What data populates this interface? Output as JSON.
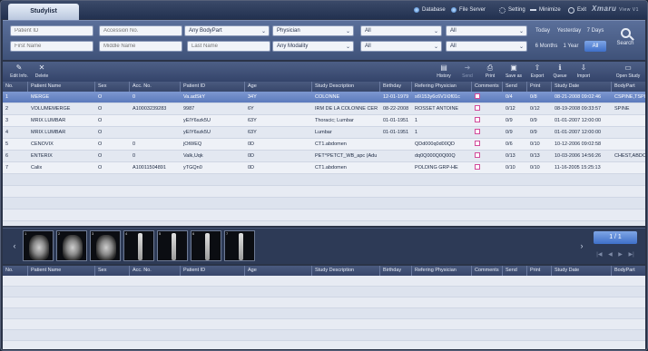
{
  "titlebar": {
    "tab": "Studylist",
    "database": "Database",
    "file_server": "File Server",
    "setting": "Setting",
    "minimize": "Minimize",
    "exit": "Exit",
    "brand": "Xmaru",
    "brand_sub": "View V1"
  },
  "search": {
    "patient_id": "Patient ID",
    "accession_no": "Accession No.",
    "first_name": "First Name",
    "middle_name": "Middle Name",
    "last_name": "Last Name",
    "bodypart": "Any BodyPart",
    "modality": "Any Modality",
    "physician": "Physician",
    "all_1": "All",
    "all_2": "All",
    "all_3": "All",
    "all_4": "All",
    "dates": {
      "today": "Today",
      "yesterday": "Yesterday",
      "seven_days": "7 Days",
      "six_months": "6 Months",
      "one_year": "1 Year",
      "all": "All"
    },
    "search_button": "Search"
  },
  "toolbar": {
    "edit_info": "Edit Info.",
    "delete": "Delete",
    "history": "History",
    "send": "Send",
    "print": "Print",
    "save_as": "Save as",
    "export": "Export",
    "queue": "Queue",
    "import": "Import",
    "open_study": "Open Study"
  },
  "columns": {
    "no": "No.",
    "patient_name": "Patient Name",
    "sex": "Sex",
    "acc_no": "Acc. No.",
    "patient_id": "Patient ID",
    "age": "Age",
    "study_description": "Study Description",
    "birthday": "Birthday",
    "referring_physician": "Refering Physician",
    "comments": "Comments",
    "send": "Send",
    "print": "Print",
    "study_date": "Study Date",
    "bodypart": "BodyPart"
  },
  "studies": [
    {
      "no": "1",
      "name": "MERGE",
      "sex": "O",
      "acc": "0",
      "pid": "Va.adSkY",
      "age": "34Y",
      "desc": "COLONNE",
      "birthday": "12-01-1979",
      "phys": "s6\\153y6c6V1\\0f01c",
      "send": "0/4",
      "print": "0/8",
      "date": "08-21-2008 09:02:46",
      "body": "CSPINE,TSPI"
    },
    {
      "no": "2",
      "name": "VOLUMEMERGE",
      "sex": "O",
      "acc": "A10003239283",
      "pid": "9987",
      "age": "6Y",
      "desc": "IRM DE LA COLONNE CER",
      "birthday": "08-22-2008",
      "phys": "ROSSET ANTOINE",
      "send": "0/12",
      "print": "0/12",
      "date": "08-19-2008 09:33:57",
      "body": "SPINE"
    },
    {
      "no": "3",
      "name": "MRIX LUMBAR",
      "sex": "O",
      "acc": "",
      "pid": "yEIY6szk5U",
      "age": "63Y",
      "desc": "Thoracic; Lumbar",
      "birthday": "01-01-1951",
      "phys": "1",
      "send": "0/9",
      "print": "0/9",
      "date": "01-01-2007 12:00:00",
      "body": ""
    },
    {
      "no": "4",
      "name": "MRIX LUMBAR",
      "sex": "O",
      "acc": "",
      "pid": "yEIY6szk5U",
      "age": "63Y",
      "desc": "Lumbar",
      "birthday": "01-01-1951",
      "phys": "1",
      "send": "0/9",
      "print": "0/9",
      "date": "01-01-2007 12:00:00",
      "body": ""
    },
    {
      "no": "5",
      "name": "CENOVIX",
      "sex": "O",
      "acc": "0",
      "pid": "jOtWEQ",
      "age": "0D",
      "desc": "CT1.abdomen",
      "birthday": "",
      "phys": "QDd000q0d00QD",
      "send": "0/6",
      "print": "0/10",
      "date": "10-12-2006 09:02:58",
      "body": ""
    },
    {
      "no": "6",
      "name": "ENTERIX",
      "sex": "O",
      "acc": "0",
      "pid": "Valk,Uqk",
      "age": "0D",
      "desc": "PET^PETCT_WB_apc (Adu",
      "birthday": "",
      "phys": "dq0Q000Q0Q00Q",
      "send": "0/13",
      "print": "0/13",
      "date": "10-03-2006 14:56:26",
      "body": "CHEST,ABDO"
    },
    {
      "no": "7",
      "name": "Calix",
      "sex": "O",
      "acc": "A10011504891",
      "pid": "yTGQn0",
      "age": "0D",
      "desc": "CT1.abdomen",
      "birthday": "",
      "phys": "POLDING GRP-HE",
      "send": "0/10",
      "print": "0/10",
      "date": "11-16-2005 15:25:13",
      "body": ""
    }
  ],
  "thumbnails": [
    "1",
    "2",
    "3",
    "4",
    "5",
    "6",
    "7"
  ],
  "pager": "1 / 1",
  "pager_nav": [
    "|◀",
    "◀",
    "▶",
    "▶|"
  ],
  "colors": {
    "selected_row": "#5c7bbd",
    "header": "#37466a",
    "accent": "#3e6fc8",
    "comment_box": "#d24a9a"
  }
}
